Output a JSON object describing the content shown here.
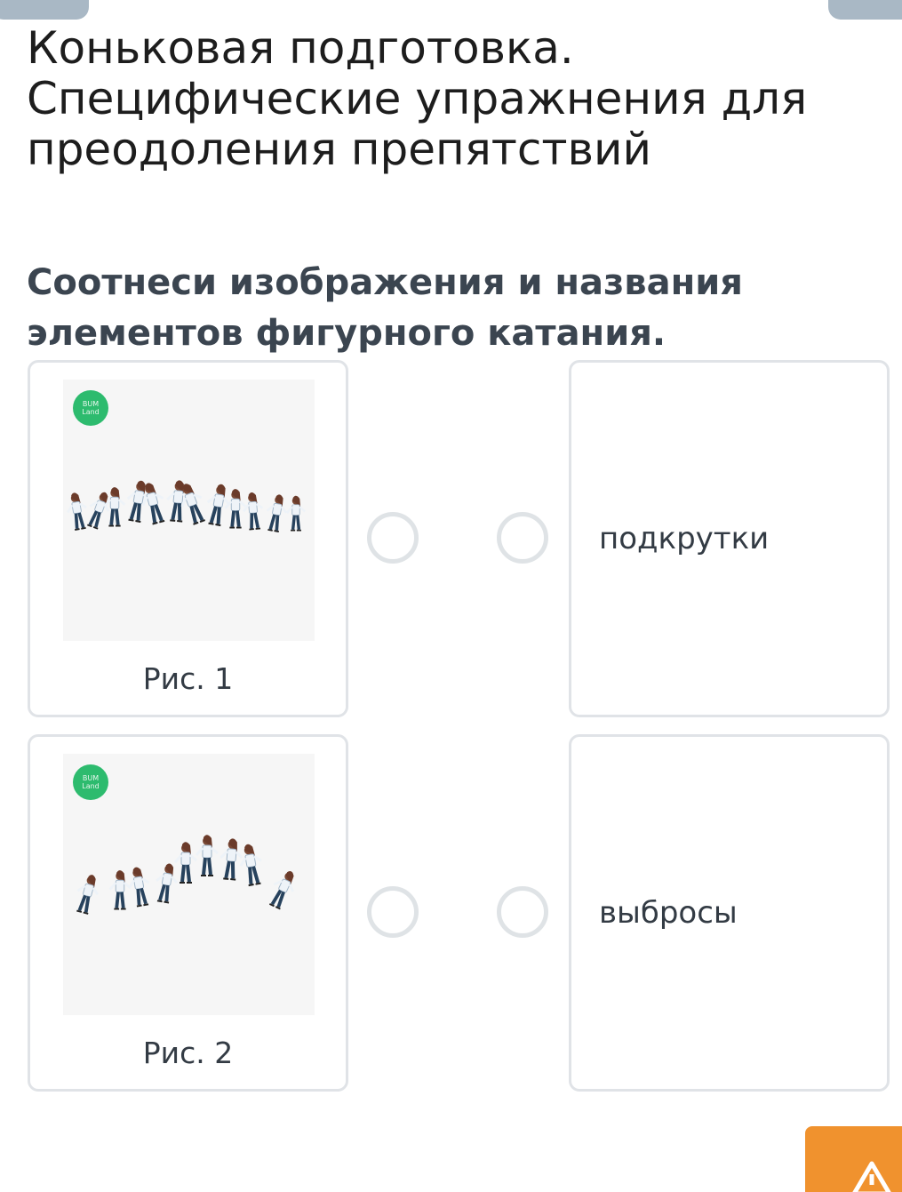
{
  "header": {
    "title": "Коньковая подготовка. Специфические упражнения для преодоления препятствий"
  },
  "task": {
    "text": "Соотнеси изображения и названия элементов фигурного катания."
  },
  "images": [
    {
      "caption": "Рис. 1",
      "logo": [
        "BUM",
        "Land"
      ],
      "icon": "skater-sequence-image"
    },
    {
      "caption": "Рис. 2",
      "logo": [
        "BUM",
        "Land"
      ],
      "icon": "skater-sequence-image"
    }
  ],
  "names": [
    {
      "label": "подкрутки"
    },
    {
      "label": "выбросы"
    }
  ],
  "colors": {
    "border": "#e0e3e7",
    "radio": "#dfe3e6",
    "logo": "#2dbb6e",
    "fab": "#f0922e",
    "top_tab": "#a9b8c5"
  },
  "fab": {
    "icon": "warning-icon"
  }
}
